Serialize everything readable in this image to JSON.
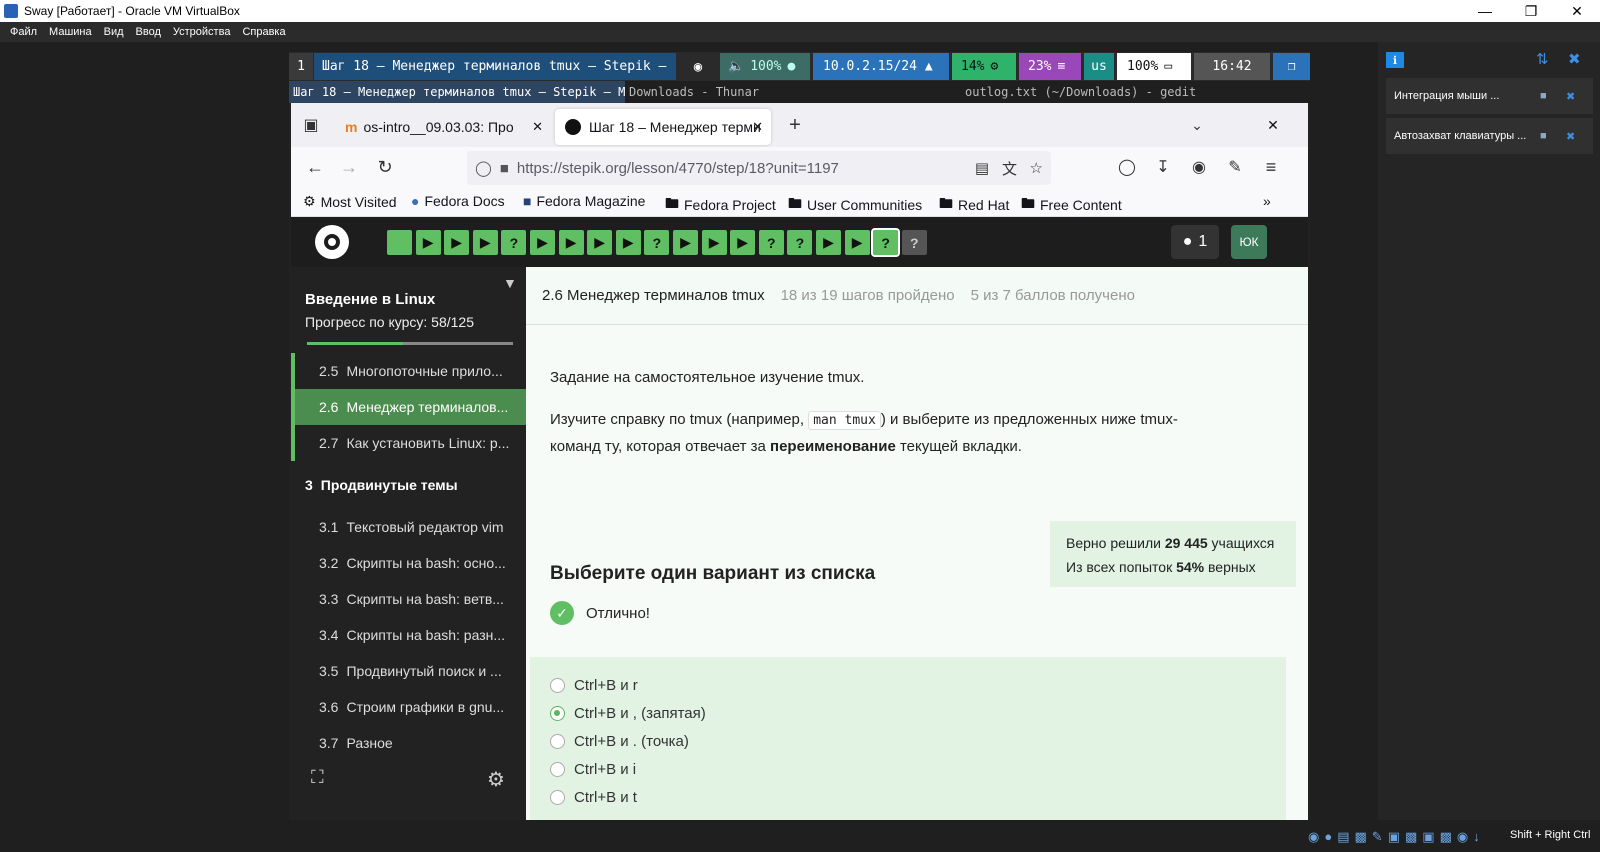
{
  "window": {
    "title": "Sway [Работает] - Oracle VM VirtualBox",
    "menu": [
      "Файл",
      "Машина",
      "Вид",
      "Ввод",
      "Устройства",
      "Справка"
    ],
    "host_key": "Shift + Right Ctrl"
  },
  "swaybar": {
    "workspace": "1",
    "window_title": "Шаг 18 – Менеджер терминалов tmux – Stepik —",
    "volume": "100%",
    "ip": "10.0.2.15/24",
    "cpu": "14%",
    "mem": "23%",
    "layout": "us",
    "battery": "100%",
    "time": "16:42"
  },
  "window_titles": {
    "active": "Шаг 18 – Менеджер терминалов tmux – Stepik — Mozi",
    "second": "Downloads - Thunar",
    "third": "outlog.txt (~/Downloads) - gedit"
  },
  "browser": {
    "tabs": [
      {
        "label": "os-intro__09.03.03: Про"
      },
      {
        "label": "Шаг 18 – Менеджер терми"
      }
    ],
    "url": "https://stepik.org/lesson/4770/step/18?unit=1197",
    "bookmarks": [
      "Most Visited",
      "Fedora Docs",
      "Fedora Magazine",
      "Fedora Project",
      "User Communities",
      "Red Hat",
      "Free Content"
    ]
  },
  "stepik": {
    "trophy_count": "1",
    "avatar": "ЮК",
    "course_title": "Введение в Linux",
    "progress_label": "Прогресс по курсу:",
    "progress_value": "58/125",
    "progress_fraction": 0.464,
    "sidebar_items": [
      {
        "num": "2.5",
        "label": "Многопоточные прило..."
      },
      {
        "num": "2.6",
        "label": "Менеджер терминалов..."
      },
      {
        "num": "2.7",
        "label": "Как установить Linux: р..."
      },
      {
        "num": "3",
        "label": "Продвинутые темы"
      },
      {
        "num": "3.1",
        "label": "Текстовый редактор vim"
      },
      {
        "num": "3.2",
        "label": "Скрипты на bash: осно..."
      },
      {
        "num": "3.3",
        "label": "Скрипты на bash: ветв..."
      },
      {
        "num": "3.4",
        "label": "Скрипты на bash: разн..."
      },
      {
        "num": "3.5",
        "label": "Продвинутый поиск и ..."
      },
      {
        "num": "3.6",
        "label": "Строим графики в gnu..."
      },
      {
        "num": "3.7",
        "label": "Разное"
      }
    ],
    "lesson_title": "2.6 Менеджер терминалов tmux",
    "steps_done": "18 из 19 шагов пройдено",
    "points": "5 из 7 баллов  получено",
    "task_intro": "Задание на самостоятельное изучение tmux.",
    "task_p1": "Изучите справку по tmux (например,",
    "task_code": "man tmux",
    "task_p2": ") и выберите из предложенных ниже tmux-",
    "task_p3": "команд ту, которая отвечает за",
    "task_bold": "переименование",
    "task_p4": "текущей вкладки.",
    "stats_l1a": "Верно решили",
    "stats_l1b": "29 445",
    "stats_l1c": "учащихся",
    "stats_l2a": "Из всех попыток",
    "stats_l2b": "54%",
    "stats_l2c": "верных",
    "choose": "Выберите один вариант из списка",
    "result": "Отлично!",
    "options": [
      {
        "label": "Ctrl+B и r",
        "selected": false
      },
      {
        "label": "Ctrl+B и , (запятая)",
        "selected": true
      },
      {
        "label": "Ctrl+B и . (точка)",
        "selected": false
      },
      {
        "label": "Ctrl+B и i",
        "selected": false
      },
      {
        "label": "Ctrl+B и t",
        "selected": false
      }
    ]
  },
  "right_panel": {
    "items": [
      "Интеграция мыши ...",
      "Автозахват клавиатуры ..."
    ]
  }
}
